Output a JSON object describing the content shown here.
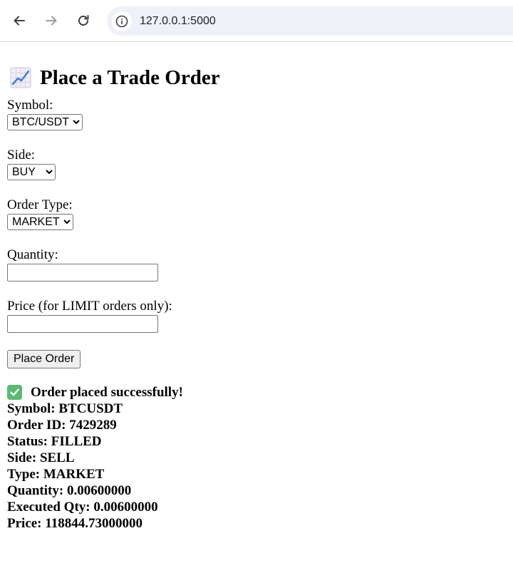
{
  "browser": {
    "url": "127.0.0.1:5000"
  },
  "page": {
    "title": "Place a Trade Order",
    "title_icon": "chart-increasing-icon"
  },
  "form": {
    "symbol_label": "Symbol:",
    "symbol_value": "BTC/USDT",
    "side_label": "Side:",
    "side_value": "BUY",
    "order_type_label": "Order Type:",
    "order_type_value": "MARKET",
    "quantity_label": "Quantity:",
    "quantity_value": "",
    "price_label": "Price (for LIMIT orders only):",
    "price_value": "",
    "submit_label": "Place Order"
  },
  "result": {
    "icon": "check-mark-icon",
    "accent_color": "#5bb974",
    "message": "Order placed successfully!",
    "rows": [
      {
        "label": "Symbol:",
        "value": "BTCUSDT"
      },
      {
        "label": "Order ID:",
        "value": "7429289"
      },
      {
        "label": "Status:",
        "value": "FILLED"
      },
      {
        "label": "Side:",
        "value": "SELL"
      },
      {
        "label": "Type:",
        "value": "MARKET"
      },
      {
        "label": "Quantity:",
        "value": "0.00600000"
      },
      {
        "label": "Executed Qty:",
        "value": "0.00600000"
      },
      {
        "label": "Price:",
        "value": "118844.73000000"
      }
    ]
  }
}
